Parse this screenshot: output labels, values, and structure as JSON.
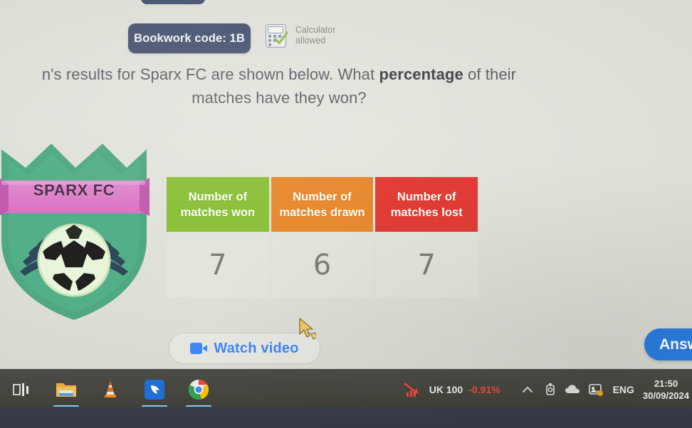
{
  "header": {
    "bookwork_code_label": "Bookwork code: 1B",
    "calculator_line1": "Calculator",
    "calculator_line2": "allowed"
  },
  "question": {
    "line1_prefix": "n's results for Sparx FC are shown below. What ",
    "line1_bold": "percentage",
    "line1_suffix": " of their",
    "line2": "matches have they won?"
  },
  "crest": {
    "club_name": "SPARX FC",
    "shield_color": "#4fa882",
    "banner_color": "#da72c4"
  },
  "table": {
    "headers": [
      {
        "line1": "Number of",
        "line2": "matches won",
        "color": "#8cc03a"
      },
      {
        "line1": "Number of",
        "line2": "matches drawn",
        "color": "#e78a30"
      },
      {
        "line1": "Number of",
        "line2": "matches lost",
        "color": "#e23c36"
      }
    ],
    "values": [
      "7",
      "6",
      "7"
    ]
  },
  "actions": {
    "watch_video_label": "Watch video",
    "answer_label": "Answ"
  },
  "taskbar": {
    "apps": [
      {
        "name": "task-view",
        "active": false
      },
      {
        "name": "file-explorer",
        "active": true
      },
      {
        "name": "vlc-media-player",
        "active": false
      },
      {
        "name": "blue-app",
        "active": true
      },
      {
        "name": "google-chrome",
        "active": true
      }
    ],
    "stock_name": "UK 100",
    "stock_change": "-0.91%",
    "language": "ENG",
    "time": "21:50",
    "date": "30/09/2024"
  }
}
